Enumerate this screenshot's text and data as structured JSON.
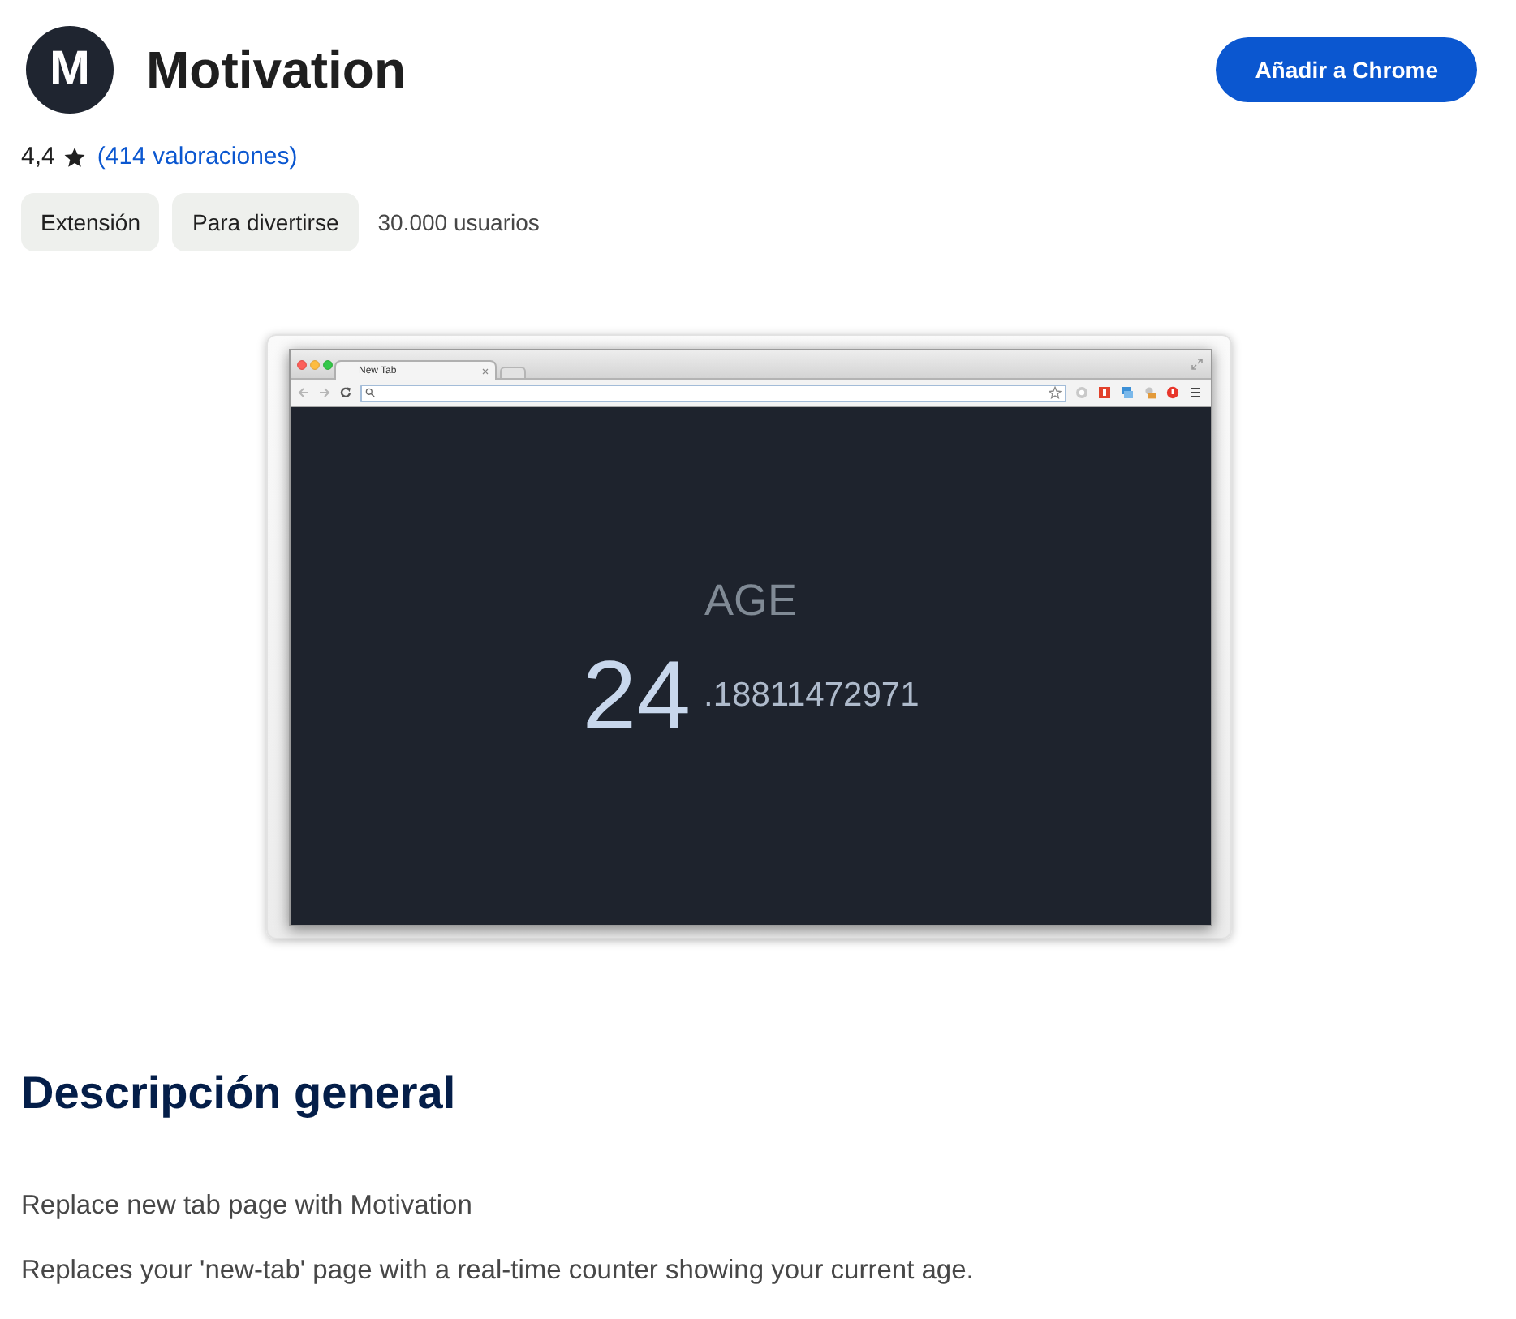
{
  "header": {
    "logo_letter": "M",
    "title": "Motivation",
    "install_button": "Añadir a Chrome"
  },
  "rating": {
    "score": "4,4",
    "reviews_link": "(414 valoraciones)"
  },
  "tags": [
    "Extensión",
    "Para divertirse"
  ],
  "users": "30.000 usuarios",
  "screenshot": {
    "tabs": [
      {
        "title": "New Tab",
        "selected": true
      }
    ],
    "counter": {
      "label": "AGE",
      "whole": "24",
      "fraction": ".18811472971"
    }
  },
  "description": {
    "heading": "Descripción general",
    "paragraphs": [
      "Replace new tab page with Motivation",
      "Replaces your 'new-tab' page with a real-time counter showing your current age."
    ]
  }
}
